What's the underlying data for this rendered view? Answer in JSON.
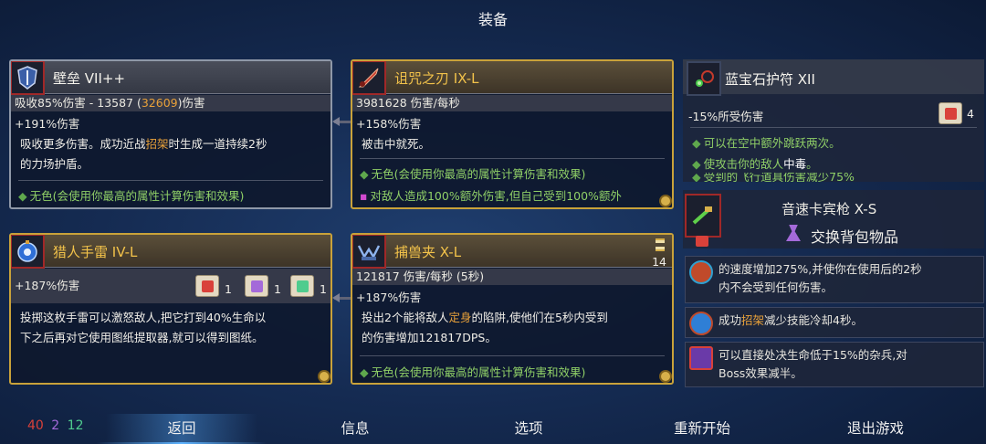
{
  "screen_title": "装备",
  "colors": {
    "gold_border": "#c9a23a",
    "gray_border": "#8f98a8",
    "orange": "#e9a13a",
    "green": "#8fcf67",
    "red": "#d9413a",
    "purple": "#a46ad9",
    "teal": "#4fcc8e"
  },
  "bulwark": {
    "name": "壁垒 VII++",
    "line1_prefix": "吸收85%伤害 - 13587 (",
    "line1_value": "32609",
    "line1_suffix": ")伤害",
    "line2": "+191%伤害",
    "desc_a": "吸收更多伤害。成功近战",
    "desc_hl": "招架",
    "desc_b": "时生成一道持续2秒",
    "desc_c": "的力场护盾。",
    "note": "无色(会使用你最高的属性计算伤害和效果)"
  },
  "cursed_sword": {
    "name": "诅咒之刃 IX-L",
    "line1": "3981628 伤害/每秒",
    "line2": "+158%伤害",
    "desc": "被击中就死。",
    "note1": "无色(会使用你最高的属性计算伤害和效果)",
    "note2": "对敌人造成100%额外伤害,但自己受到100%额外"
  },
  "sapphire_amulet": {
    "name": "蓝宝石护符 XII",
    "line1": "-15%所受伤害",
    "scroll_count": "4",
    "note1": "可以在空中额外跳跃两次。",
    "note2_a": "使攻击你的敌人",
    "note2_hl": "中毒",
    "note2_b": "。",
    "note3": "受到的飞行道具伤害减少75%"
  },
  "grenade": {
    "name": "猎人手雷 IV-L",
    "line1": "+187%伤害",
    "scrolls": [
      {
        "icon": "brutality-scroll-icon",
        "color": "#d9413a",
        "count": "1"
      },
      {
        "icon": "tactics-scroll-icon",
        "color": "#a46ad9",
        "count": "1"
      },
      {
        "icon": "survival-scroll-icon",
        "color": "#4fcc8e",
        "count": "1"
      }
    ],
    "desc_a": "投掷这枚手雷可以激怒敌人,把它打到40%生命以",
    "desc_b": "下之后再对它使用图纸提取器,就可以得到图纸。"
  },
  "bear_trap": {
    "name": "捕兽夹 X-L",
    "line1": "121817 伤害/每秒 (5秒)",
    "line2": "+187%伤害",
    "timer": "14",
    "desc_a": "投出2个能将敌人",
    "desc_hl": "定身",
    "desc_b": "的陷阱,使他们在5秒内受到",
    "desc_c": "的伤害增加121817DPS。",
    "note": "无色(会使用你最高的属性计算伤害和效果)"
  },
  "backpack": {
    "item_name": "音速卡宾枪 X-S",
    "swap_label": "交换背包物品"
  },
  "effects": [
    {
      "icon": "speed-mutation-icon",
      "text_a": "的速度增加275%,并使你在使用后的2秒",
      "text_b": "内不会受到任何伤害。"
    },
    {
      "icon": "parry-mutation-icon",
      "text_pre": "成功",
      "text_hl": "招架",
      "text_post": "减少技能冷却4秒。"
    },
    {
      "icon": "execution-mutation-icon",
      "text_a": "可以直接处决生命低于15%的杂兵,对",
      "text_b": "Boss效果减半。"
    }
  ],
  "stats": {
    "brutality": "40",
    "tactics": "2",
    "survival": "12"
  },
  "menu": {
    "back": "返回",
    "info": "信息",
    "options": "选项",
    "restart": "重新开始",
    "quit": "退出游戏"
  }
}
